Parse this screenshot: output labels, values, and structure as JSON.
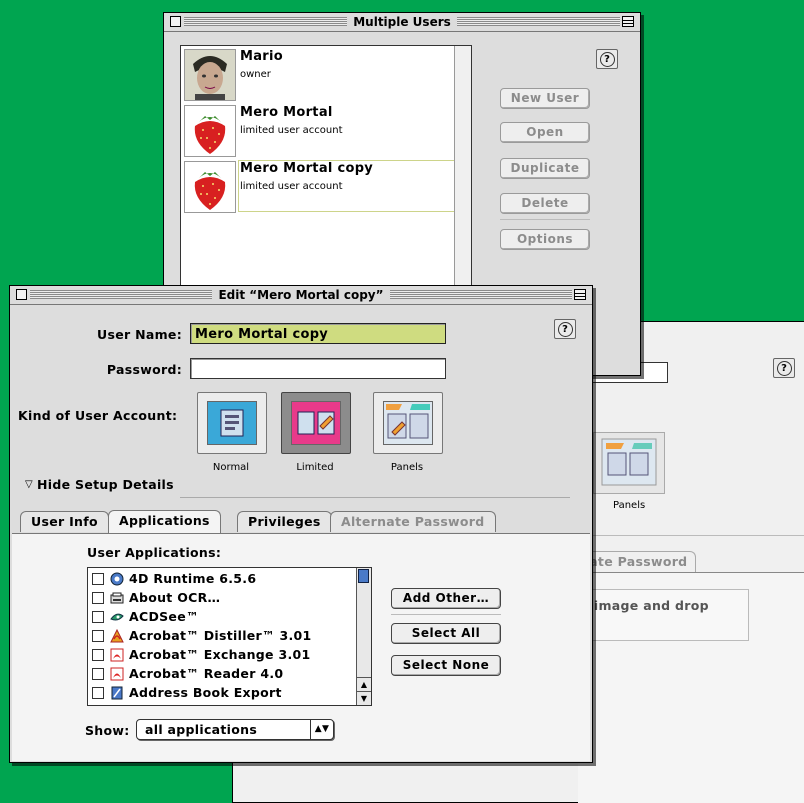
{
  "background_color": "#00a550",
  "back_window": {
    "help_label": "?",
    "panels_caption": "Panels",
    "tab_partial": "nate Password",
    "content_partial": "g image and drop"
  },
  "multiple_users": {
    "title": "Multiple Users",
    "help_label": "?",
    "users": [
      {
        "name": "Mario",
        "description": "owner",
        "avatar": "photo-avatar"
      },
      {
        "name": "Mero Mortal",
        "description": "limited user account",
        "avatar": "strawberry-avatar"
      },
      {
        "name": "Mero Mortal copy",
        "description": "limited user account",
        "avatar": "strawberry-avatar"
      }
    ],
    "buttons": {
      "new_user": "New User",
      "open": "Open",
      "duplicate": "Duplicate",
      "delete": "Delete",
      "options": "Options"
    }
  },
  "edit_window": {
    "title": "Edit “Mero Mortal copy”",
    "help_label": "?",
    "user_name_label": "User Name:",
    "user_name_value": "Mero Mortal copy",
    "password_label": "Password:",
    "password_value": "",
    "kind_label": "Kind of User Account:",
    "kinds": {
      "normal": "Normal",
      "limited": "Limited",
      "panels": "Panels",
      "selected": "Limited"
    },
    "hide_setup": "Hide Setup Details",
    "tabs": {
      "user_info": "User Info",
      "applications": "Applications",
      "privileges": "Privileges",
      "alternate_password": "Alternate Password"
    },
    "user_applications_label": "User Applications:",
    "applications": [
      {
        "name": "4D Runtime 6.5.6",
        "icon": "4d-runtime-icon"
      },
      {
        "name": "About OCR…",
        "icon": "scanner-icon"
      },
      {
        "name": "ACDSee™",
        "icon": "acdsee-icon"
      },
      {
        "name": "Acrobat™ Distiller™ 3.01",
        "icon": "acrobat-distiller-icon"
      },
      {
        "name": "Acrobat™ Exchange 3.01",
        "icon": "acrobat-icon"
      },
      {
        "name": "Acrobat™ Reader 4.0",
        "icon": "acrobat-icon"
      },
      {
        "name": "Address Book Export",
        "icon": "address-book-icon"
      }
    ],
    "buttons": {
      "add_other": "Add Other…",
      "select_all": "Select All",
      "select_none": "Select None"
    },
    "show_label": "Show:",
    "show_value": "all applications"
  }
}
